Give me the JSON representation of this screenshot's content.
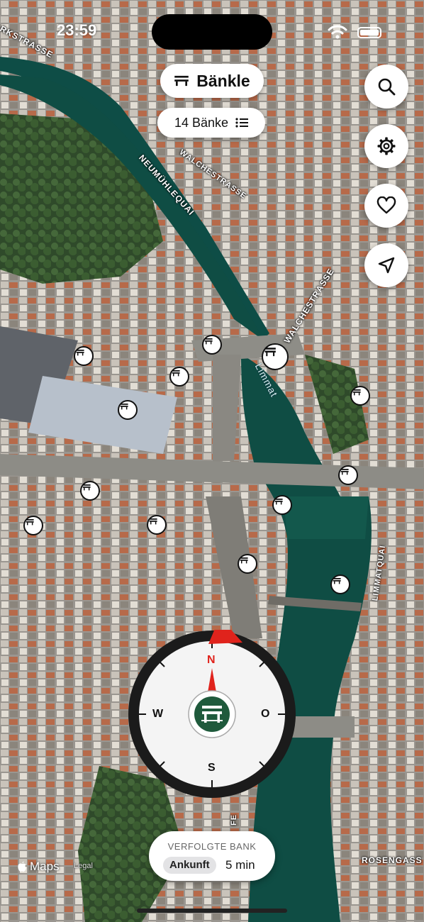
{
  "status_bar": {
    "time": "23:59"
  },
  "header": {
    "title": "Bänkle",
    "bench_count_label": "14 Bänke"
  },
  "map": {
    "street_labels": {
      "werdstrasse": "RKSTRASSE",
      "walchestrasse_top": "WALCHESTRASSE",
      "neumuehlequai": "NEUMÜHLEQUAI",
      "walchestrasse_right": "WALCHESTRASSE",
      "limmatquai": "LIMMATQUAI",
      "rosengasse": "ROSENGASS",
      "bottom_fe": "FE"
    },
    "river_label": "Limmat",
    "maps_label": "Maps",
    "legal_label": "Legal"
  },
  "compass": {
    "north": "N",
    "east": "O",
    "south": "S",
    "west": "W"
  },
  "tracked_bank": {
    "title": "VERFOLGTE BANK",
    "arrival_label": "Ankunft",
    "arrival_time": "5 min"
  },
  "icons": {
    "search": "search-icon",
    "settings": "gear-icon",
    "favorites": "heart-icon",
    "location": "location-arrow-icon",
    "bench": "bench-icon",
    "list": "list-icon"
  },
  "colors": {
    "accent_green": "#1f5a3c",
    "compass_red": "#e0231c",
    "water": "#0f4d44"
  }
}
